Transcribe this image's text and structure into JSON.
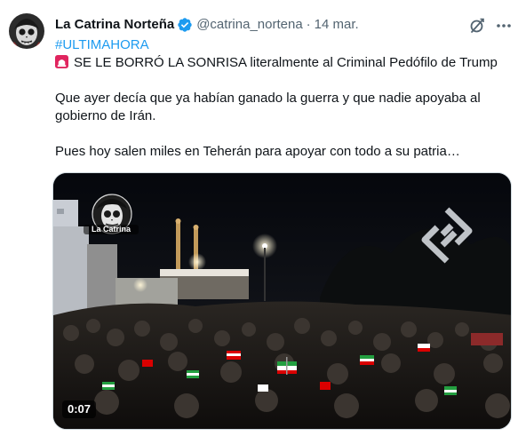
{
  "author": {
    "display_name": "La Catrina Norteña",
    "handle": "@catrina_nortena",
    "separator": "·",
    "date": "14 mar.",
    "verified_color": "#1d9bf0",
    "avatar_icon": "skull-avatar-icon"
  },
  "header_icons": {
    "grok": "grok-icon",
    "more": "more-icon"
  },
  "tweet": {
    "hashtag": "#ULTIMAHORA",
    "line1": "SE LE BORRÓ LA SONRISA literalmente al Criminal Pedófilo de Trump",
    "line1_emoji": "siren-icon",
    "para2_line1": "Que ayer decía que ya habían ganado la guerra y que nadie apoyaba al",
    "para2_line2": "gobierno de Irán.",
    "para3": "Pues hoy salen miles en Teherán para apoyar con todo a su patria…"
  },
  "media": {
    "type": "video",
    "duration": "0:07",
    "watermark_label": "La Catrina",
    "channel_watermark": "channel-logo-icon"
  },
  "colors": {
    "text": "#0f1419",
    "secondary": "#536471",
    "link": "#1d9bf0"
  }
}
